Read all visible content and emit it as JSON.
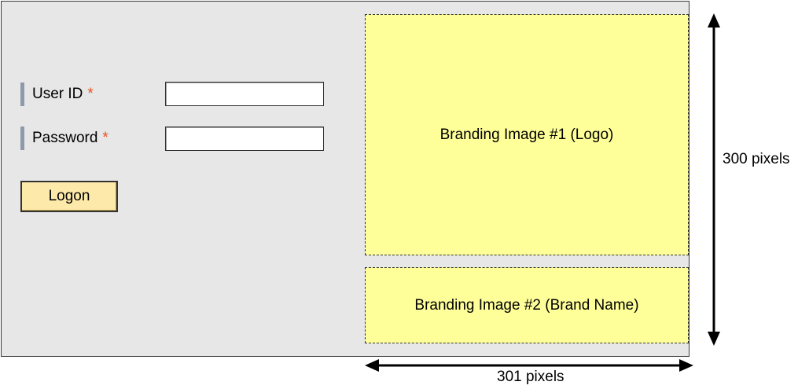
{
  "login_form": {
    "user_id_label": "User ID",
    "password_label": "Password",
    "required_marker": "*",
    "logon_button_label": "Logon",
    "user_id_value": "",
    "password_value": ""
  },
  "branding": {
    "logo_label": "Branding Image #1 (Logo)",
    "brand_name_label": "Branding Image #2 (Brand Name)"
  },
  "dimensions": {
    "height_label": "300 pixels",
    "width_label": "301 pixels"
  },
  "colors": {
    "panel_background": "#e7e7e7",
    "required_marker": "#e8531f",
    "label_marker": "#8e99aa",
    "button_background": "#fde9a9",
    "branding_background": "#ffff99"
  },
  "icons": {
    "vertical_dimension": "double-headed-vertical-arrow-icon",
    "horizontal_dimension": "double-headed-horizontal-arrow-icon"
  }
}
